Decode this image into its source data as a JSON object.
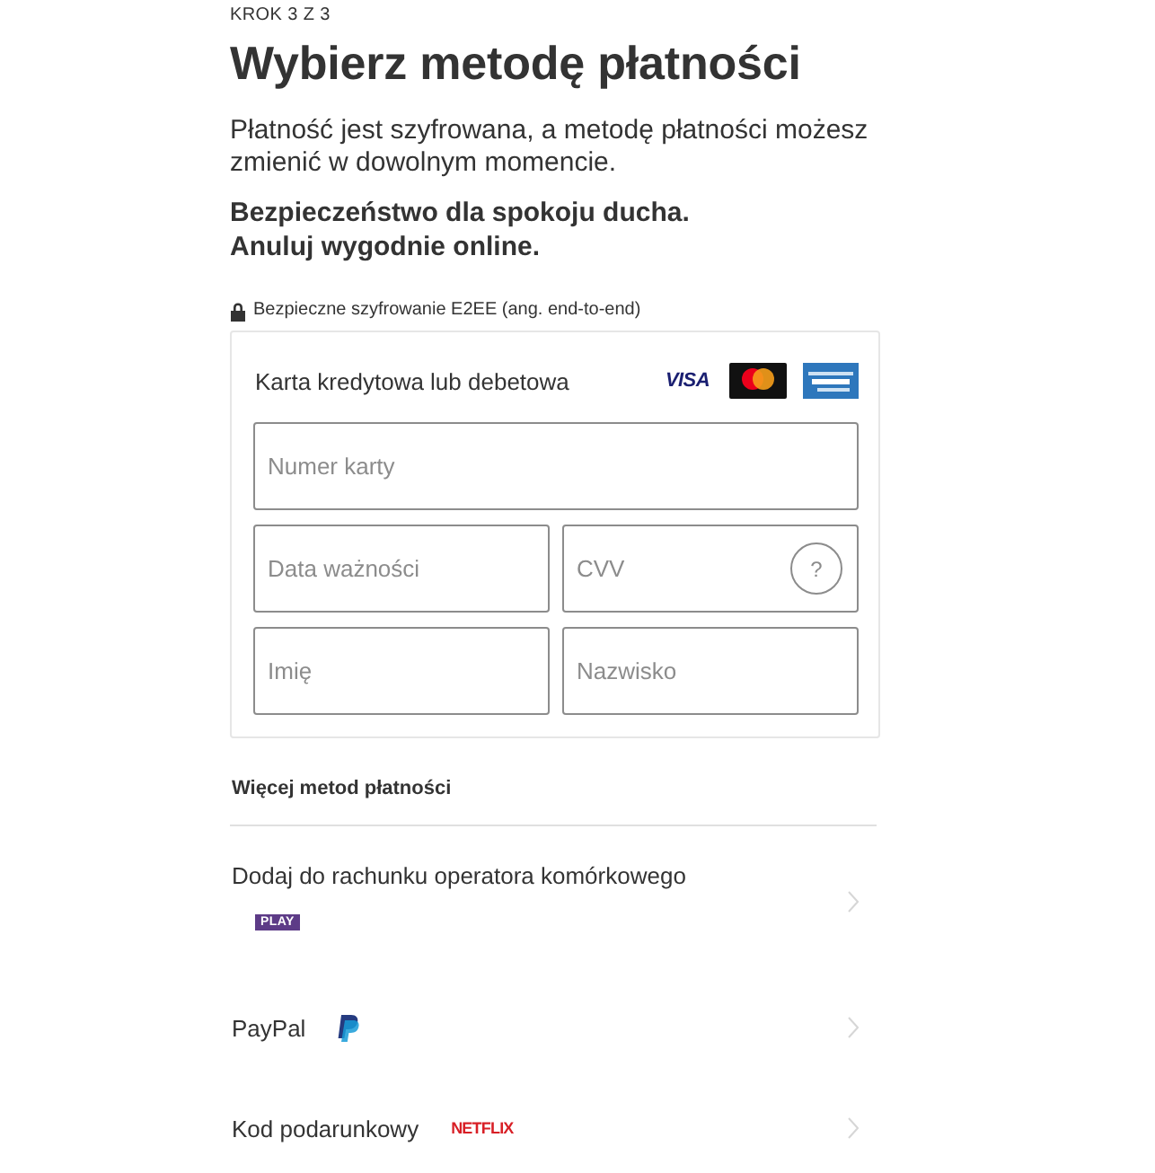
{
  "step": "KROK 3 Z 3",
  "title": "Wybierz metodę płatności",
  "intro": "Płatność jest szyfrowana, a metodę płatności możesz zmienić w dowolnym momencie.",
  "reassurance": [
    "Bezpieczeństwo dla spokoju ducha.",
    "Anuluj wygodnie online."
  ],
  "security_note": "Bezpieczne szyfrowanie E2EE (ang. end-to-end)",
  "card_form": {
    "title": "Karta kredytowa lub debetowa",
    "brands": [
      {
        "kind": "visa",
        "label": "VISA"
      },
      {
        "kind": "mastercard"
      },
      {
        "kind": "amex"
      }
    ],
    "field_rows": [
      [
        {
          "placeholder": "Numer karty"
        }
      ],
      [
        {
          "placeholder": "Data ważności"
        },
        {
          "placeholder": "CVV",
          "help_label": "?"
        }
      ],
      [
        {
          "placeholder": "Imię"
        },
        {
          "placeholder": "Nazwisko"
        }
      ]
    ]
  },
  "more_methods": {
    "title": "Więcej metod płatności",
    "items": [
      {
        "label": "Dodaj do rachunku operatora komórkowego",
        "logo": {
          "kind": "play",
          "label": "PLAY"
        },
        "logo_below": true
      },
      {
        "label": "PayPal",
        "logo": {
          "kind": "paypal"
        },
        "logo_below": false
      },
      {
        "label": "Kod podarunkowy",
        "logo": {
          "kind": "netflix",
          "label": "NETFLIX"
        },
        "logo_below": false
      }
    ]
  }
}
